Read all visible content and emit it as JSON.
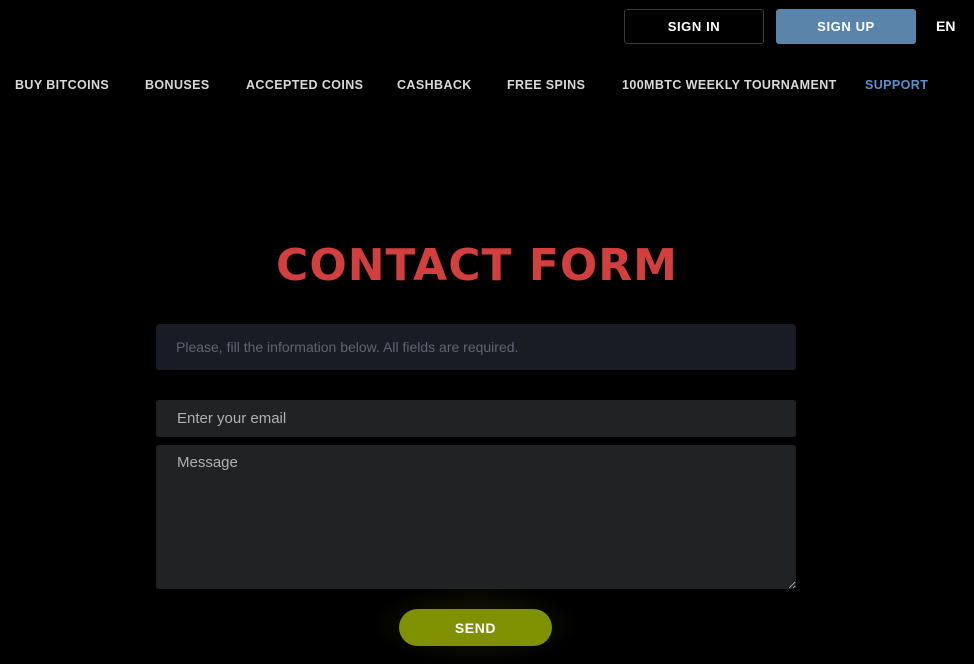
{
  "header": {
    "sign_in_label": "SIGN IN",
    "sign_up_label": "SIGN UP",
    "language": "EN"
  },
  "nav": {
    "items": [
      {
        "label": "BUY BITCOINS",
        "active": false
      },
      {
        "label": "BONUSES",
        "active": false
      },
      {
        "label": "ACCEPTED COINS",
        "active": false
      },
      {
        "label": "CASHBACK",
        "active": false
      },
      {
        "label": "FREE SPINS",
        "active": false
      },
      {
        "label": "100MBTC WEEKLY TOURNAMENT",
        "active": false
      },
      {
        "label": "SUPPORT",
        "active": true
      }
    ]
  },
  "form": {
    "title": "CONTACT FORM",
    "info_text": "Please, fill the information below. All fields are required.",
    "email_placeholder": "Enter your email",
    "email_value": "",
    "message_placeholder": "Message",
    "message_value": "",
    "send_label": "SEND"
  },
  "colors": {
    "title": "#d23f3f",
    "sign_up_bg": "#5b84aa",
    "active_nav": "#5b8fc9",
    "send_bg": "#7f9000"
  }
}
